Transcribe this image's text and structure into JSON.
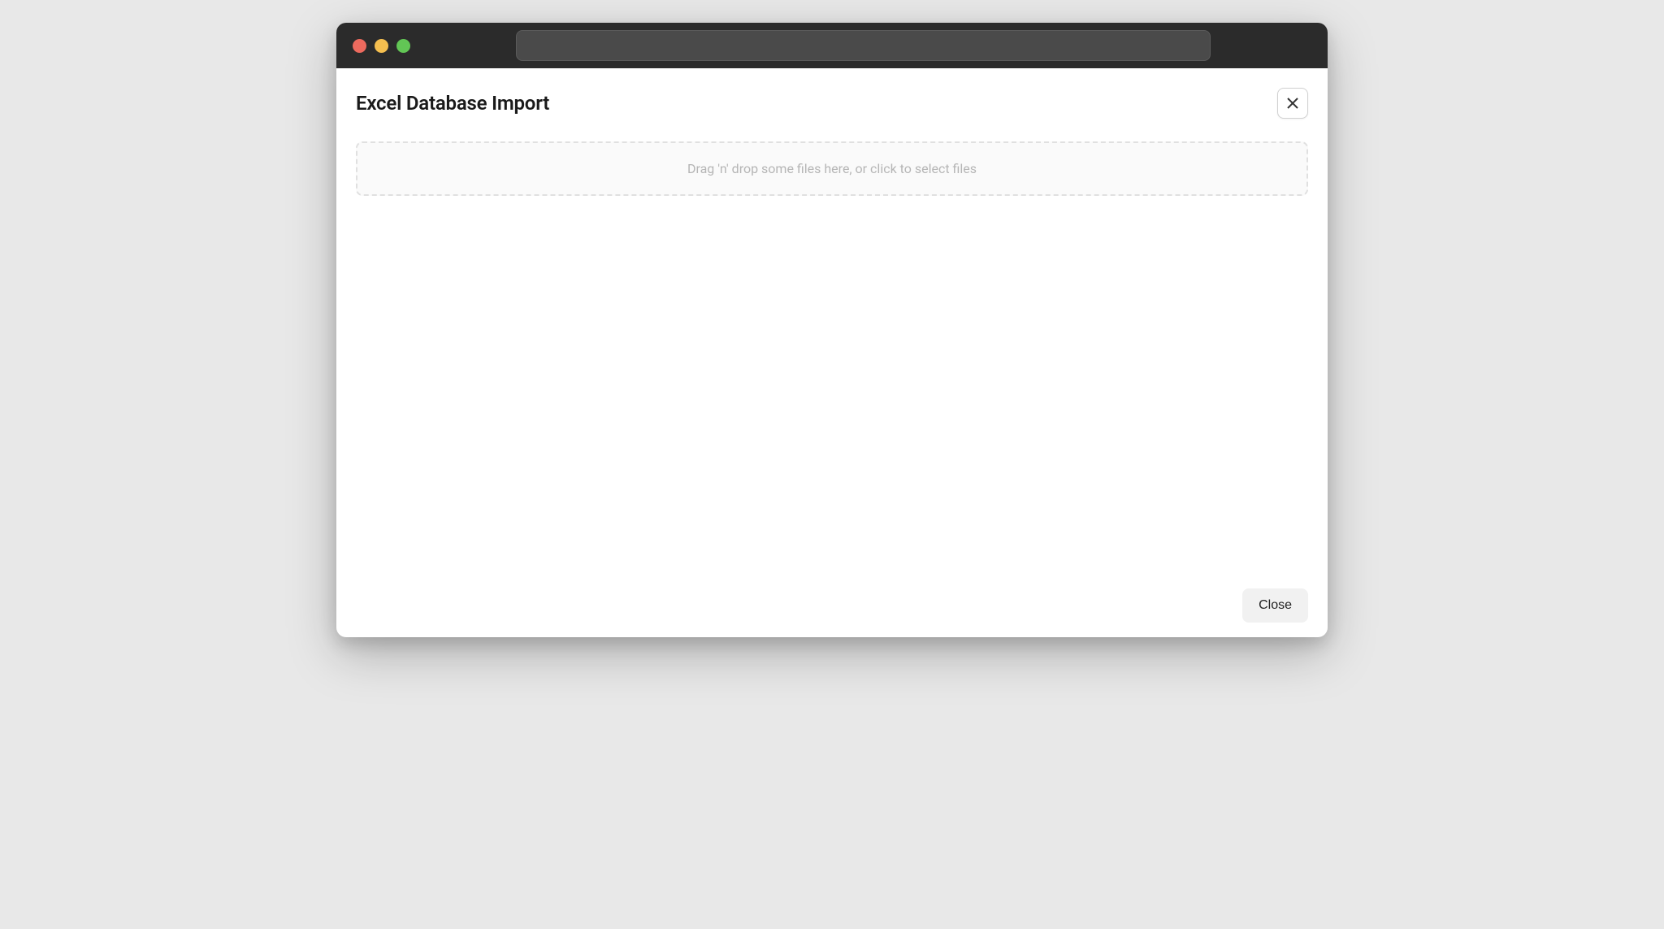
{
  "modal": {
    "title": "Excel Database Import",
    "dropzone_text": "Drag 'n' drop some files here, or click to select files",
    "close_button_label": "Close"
  }
}
